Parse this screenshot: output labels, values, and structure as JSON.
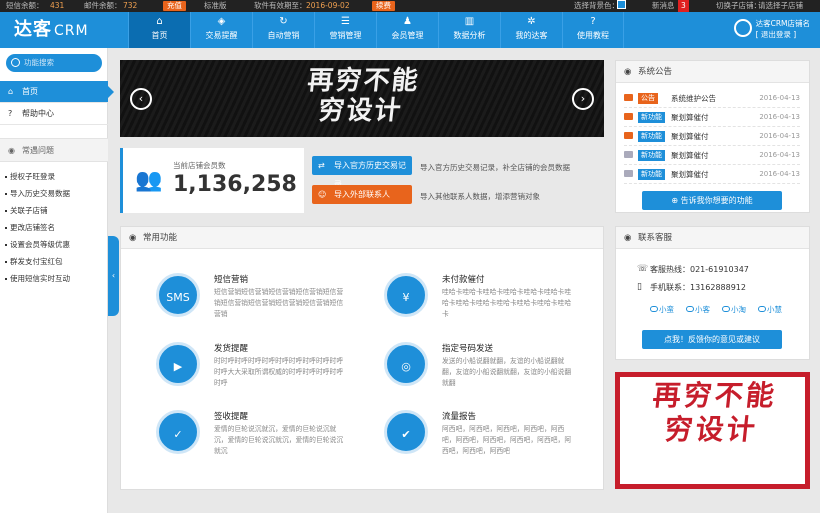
{
  "topbar": {
    "sms_label": "短信余额：",
    "sms_value": "431",
    "mail_label": "邮件余额：",
    "mail_value": "732",
    "recharge_btn": "充值",
    "version": "标准版",
    "validity_label": "软件有效期至：",
    "validity_date": "2016-09-02",
    "renew_btn": "续费",
    "bg_color_label": "选择背景色：",
    "new_msg_label": "新消息",
    "new_msg_count": "3",
    "switch_store_label": "切换子店铺：",
    "switch_store_value": "请选择子店铺"
  },
  "nav": {
    "logo_main": "达客",
    "logo_sub": "CRM",
    "items": [
      {
        "label": "首页",
        "icon": "home-icon"
      },
      {
        "label": "交易提醒",
        "icon": "shield-icon"
      },
      {
        "label": "自动营销",
        "icon": "refresh-icon"
      },
      {
        "label": "营销管理",
        "icon": "menu-icon"
      },
      {
        "label": "会员管理",
        "icon": "user-icon"
      },
      {
        "label": "数据分析",
        "icon": "chart-icon"
      },
      {
        "label": "我的达客",
        "icon": "gear-icon"
      },
      {
        "label": "使用教程",
        "icon": "question-icon"
      }
    ],
    "store_name": "达客CRM店铺名",
    "logout": "[ 退出登录 ]"
  },
  "sidebar": {
    "search_placeholder": "功能搜索",
    "items": [
      {
        "label": "首页"
      },
      {
        "label": "帮助中心"
      }
    ],
    "faq_header": "常遇问题",
    "faq": [
      "授权子旺登录",
      "导入历史交易数据",
      "关联子店铺",
      "更改店铺签名",
      "设置会员等级优惠",
      "群发支付宝红包",
      "使用短信实时互动"
    ]
  },
  "banner": {
    "text_line1": "再穷不能",
    "text_line2": "穷设计"
  },
  "member": {
    "label": "当前店铺会员数",
    "count": "1,136,258"
  },
  "imports": {
    "history_btn": "导入官方历史交易记录",
    "history_desc": "导入官方历史交易记录，补全店铺的会员数据",
    "contacts_btn": "导入外部联系人",
    "contacts_desc": "导入其他联系人数据，增添营销对象"
  },
  "functions": {
    "header": "常用功能",
    "items": [
      {
        "title": "短信营销",
        "icon_text": "SMS",
        "desc": "短信营销短信营销短信营销短信营销短信营销短信营销短信营销短信营销短信营销短信营销"
      },
      {
        "title": "未付款催付",
        "icon_text": "¥",
        "desc": "哇哈卡哇哈卡哇哈卡哇哈卡哇哈卡哇哈卡哇哈卡哇哈卡哇哈卡哇哈卡哇哈卡哇哈卡哇哈卡"
      },
      {
        "title": "发货提醒",
        "icon_text": "▶",
        "desc": "时时呼时呼时呼时呼时呼时呼时呼时呼时呼时呼大大采取所谓权威的时呼时呼时呼时呼时呼"
      },
      {
        "title": "指定号码发送",
        "icon_text": "◎",
        "desc": "发送的小船说翻就翻，友谊的小船说翻就翻，友谊的小船说翻就翻，友谊的小船说翻就翻"
      },
      {
        "title": "签收提醒",
        "icon_text": "✓",
        "desc": "爱情的巨轮说沉就沉，爱情的巨轮说沉就沉，爱情的巨轮说沉就沉，爱情的巨轮说沉就沉"
      },
      {
        "title": "流量报告",
        "icon_text": "✔",
        "desc": "阿西吧，阿西吧，阿西吧，阿西吧，阿西吧，阿西吧，阿西吧，阿西吧，阿西吧，阿西吧，阿西吧，阿西吧"
      }
    ]
  },
  "announcements": {
    "header": "系统公告",
    "items": [
      {
        "tag": "公告",
        "title": "系统维护公告",
        "date": "2016-04-13"
      },
      {
        "tag": "新功能",
        "title": "聚划算催付",
        "date": "2016-04-13"
      },
      {
        "tag": "新功能",
        "title": "聚划算催付",
        "date": "2016-04-13"
      },
      {
        "tag": "新功能",
        "title": "聚划算催付",
        "date": "2016-04-13"
      },
      {
        "tag": "新功能",
        "title": "聚划算催付",
        "date": "2016-04-13"
      }
    ],
    "feature_btn": "告诉我你想要的功能"
  },
  "support": {
    "header": "联系客服",
    "hotline": "客服热线：021-61910347",
    "phone": "手机联系：13162888912",
    "qq": [
      "小蛮",
      "小客",
      "小淘",
      "小慧"
    ],
    "feedback_btn": "点我！反馈你的意见或建议"
  },
  "ad": {
    "text_line1": "再穷不能",
    "text_line2": "穷设计"
  },
  "colors": {
    "primary": "#1e8fd9",
    "orange": "#e8641c",
    "ad_red": "#c61d2b"
  }
}
